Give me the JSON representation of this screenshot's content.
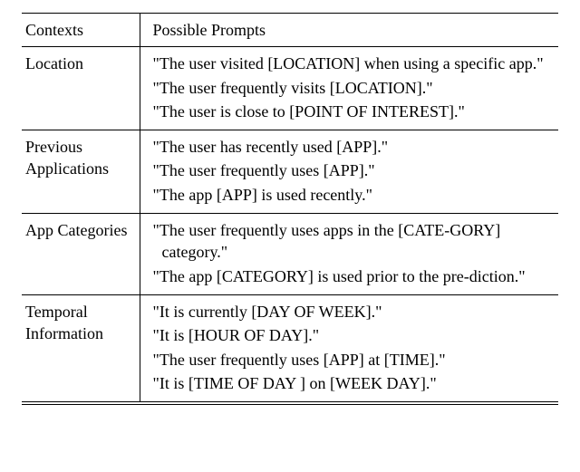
{
  "header": {
    "contexts": "Contexts",
    "prompts": "Possible Prompts"
  },
  "rows": [
    {
      "context_l1": "Location",
      "context_l2": "",
      "p1": "\"The user visited [LOCATION] when using a specific app.\"",
      "p2": "\"The user frequently visits [LOCATION].\"",
      "p3": "\"The user is close to [POINT OF INTEREST].\"",
      "p4": ""
    },
    {
      "context_l1": "Previous",
      "context_l2": "Applications",
      "p1": "\"The user has recently used [APP].\"",
      "p2": "\"The user frequently uses [APP].\"",
      "p3": "\"The app [APP] is used recently.\"",
      "p4": ""
    },
    {
      "context_l1": "App Categories",
      "context_l2": "",
      "p1": "\"The user frequently uses apps in the [CATE-GORY] category.\"",
      "p2": "\"The app [CATEGORY] is used prior to the pre-diction.\"",
      "p3": "",
      "p4": ""
    },
    {
      "context_l1": "Temporal",
      "context_l2": "Information",
      "p1": "\"It is currently [DAY OF WEEK].\"",
      "p2": "\"It is [HOUR OF DAY].\"",
      "p3": "\"The user frequently uses [APP] at [TIME].\"",
      "p4": "\"It is [TIME OF DAY ] on [WEEK DAY].\""
    }
  ],
  "chart_data": {
    "type": "table",
    "columns": [
      "Contexts",
      "Possible Prompts"
    ],
    "rows": [
      {
        "context": "Location",
        "prompts": [
          "\"The user visited [LOCATION] when using a specific app.\"",
          "\"The user frequently visits [LOCATION].\"",
          "\"The user is close to [POINT OF INTEREST].\""
        ]
      },
      {
        "context": "Previous Applications",
        "prompts": [
          "\"The user has recently used [APP].\"",
          "\"The user frequently uses [APP].\"",
          "\"The app [APP] is used recently.\""
        ]
      },
      {
        "context": "App Categories",
        "prompts": [
          "\"The user frequently uses apps in the [CATEGORY] category.\"",
          "\"The app [CATEGORY] is used prior to the prediction.\""
        ]
      },
      {
        "context": "Temporal Information",
        "prompts": [
          "\"It is currently [DAY OF WEEK].\"",
          "\"It is [HOUR OF DAY].\"",
          "\"The user frequently uses [APP] at [TIME].\"",
          "\"It is [TIME OF DAY ] on [WEEK DAY].\""
        ]
      }
    ]
  }
}
